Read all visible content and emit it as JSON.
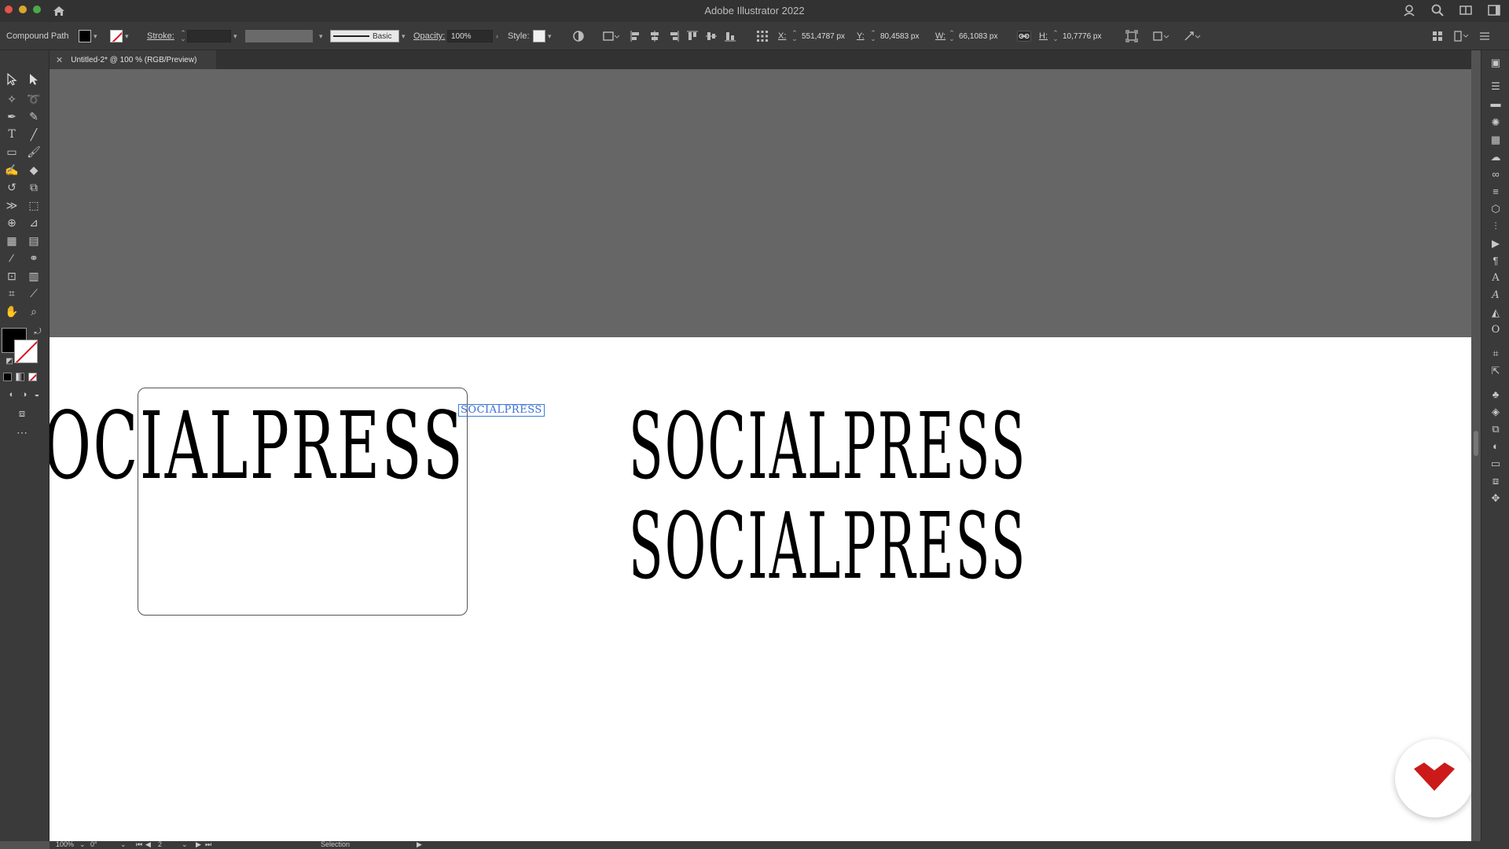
{
  "window": {
    "title": "Adobe Illustrator 2022"
  },
  "controlbar": {
    "selection_type": "Compound Path",
    "stroke_label": "Stroke:",
    "stroke_profile": "Basic",
    "opacity_label": "Opacity:",
    "opacity_value": "100%",
    "style_label": "Style:",
    "x_label": "X:",
    "x_value": "551,4787 px",
    "y_label": "Y:",
    "y_value": "80,4583 px",
    "w_label": "W:",
    "w_value": "66,1083 px",
    "h_label": "H:",
    "h_value": "10,7776 px"
  },
  "document": {
    "tab_title": "Untitled-2* @ 100 % (RGB/Preview)"
  },
  "canvas": {
    "wordmark_left": "OCIALPRESS",
    "wordmark_small": "SOCIALPRESS",
    "wordmark_right_1": "SOCIALPRESS",
    "wordmark_right_2": "SOCIALPRESS"
  },
  "statusbar": {
    "zoom": "100%",
    "rotation": "0°",
    "artboard_number": "2",
    "tool": "Selection"
  },
  "colors": {
    "fill": "#000000",
    "stroke": "none",
    "selection_blue": "#3b7bd6",
    "logo_red": "#cc1a1a"
  },
  "icons": {
    "tools": [
      "selection-tool-icon",
      "direct-selection-tool-icon",
      "magic-wand-icon",
      "lasso-icon",
      "pen-tool-icon",
      "curvature-tool-icon",
      "type-tool-icon",
      "line-tool-icon",
      "rectangle-tool-icon",
      "paintbrush-icon",
      "shaper-icon",
      "eraser-icon",
      "rotate-icon",
      "scale-icon",
      "width-tool-icon",
      "free-transform-icon",
      "shape-builder-icon",
      "perspective-icon",
      "mesh-icon",
      "gradient-icon",
      "eyedropper-icon",
      "blend-icon",
      "symbol-sprayer-icon",
      "graph-icon",
      "artboard-tool-icon",
      "slice-icon",
      "hand-tool-icon",
      "zoom-tool-icon"
    ]
  }
}
